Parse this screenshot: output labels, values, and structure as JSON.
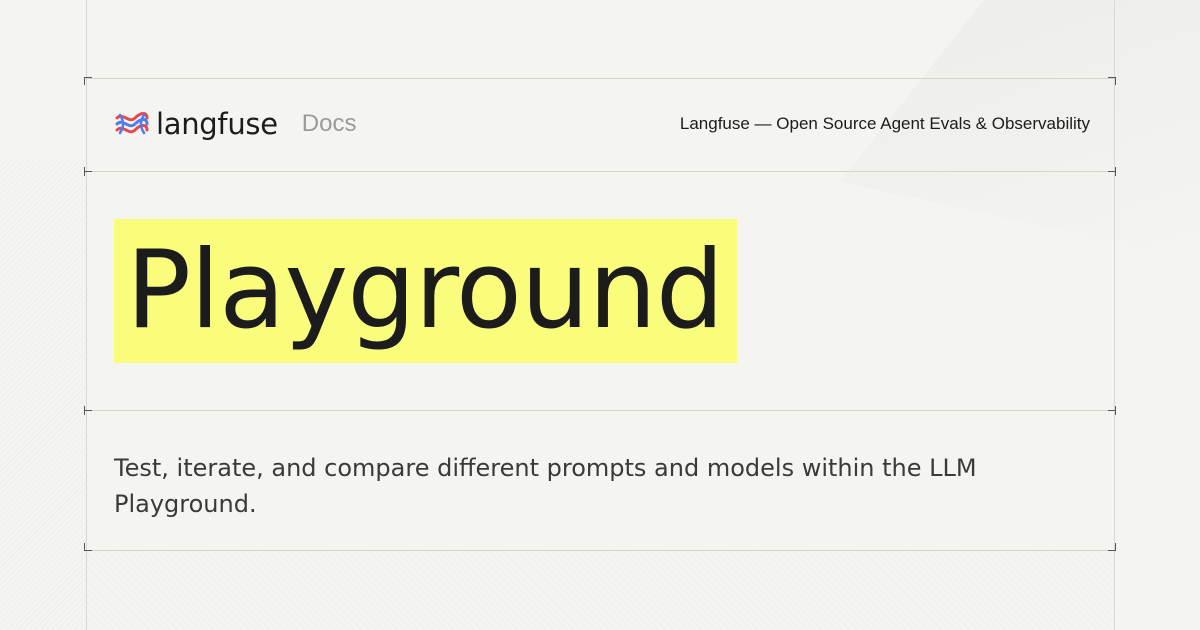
{
  "brand": {
    "name": "langfuse",
    "section": "Docs",
    "logo_icon": "langfuse-knot-icon",
    "logo_colors": [
      "#e5484d",
      "#4f7df0"
    ]
  },
  "header": {
    "tagline": "Langfuse — Open Source Agent Evals & Observability"
  },
  "hero": {
    "title": "Playground",
    "highlight_color": "#fafd7c"
  },
  "description": "Test, iterate, and compare different prompts and models within the LLM Playground."
}
